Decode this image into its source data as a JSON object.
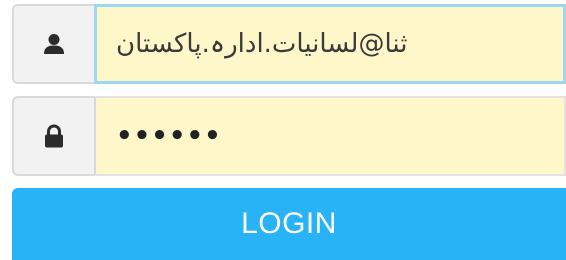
{
  "login_form": {
    "username": {
      "icon": "user-icon",
      "value": "ثنا@لسانیات.ادارہ.پاکستان"
    },
    "password": {
      "icon": "lock-icon",
      "masked_value": "••••••"
    },
    "login_button": {
      "label": "LOGIN"
    }
  },
  "colors": {
    "field_background": "#fdf7c9",
    "focus_border": "#9ed7f0",
    "addon_background": "#f2f2f2",
    "button_background": "#27b3f5",
    "button_text": "#ffffff"
  }
}
